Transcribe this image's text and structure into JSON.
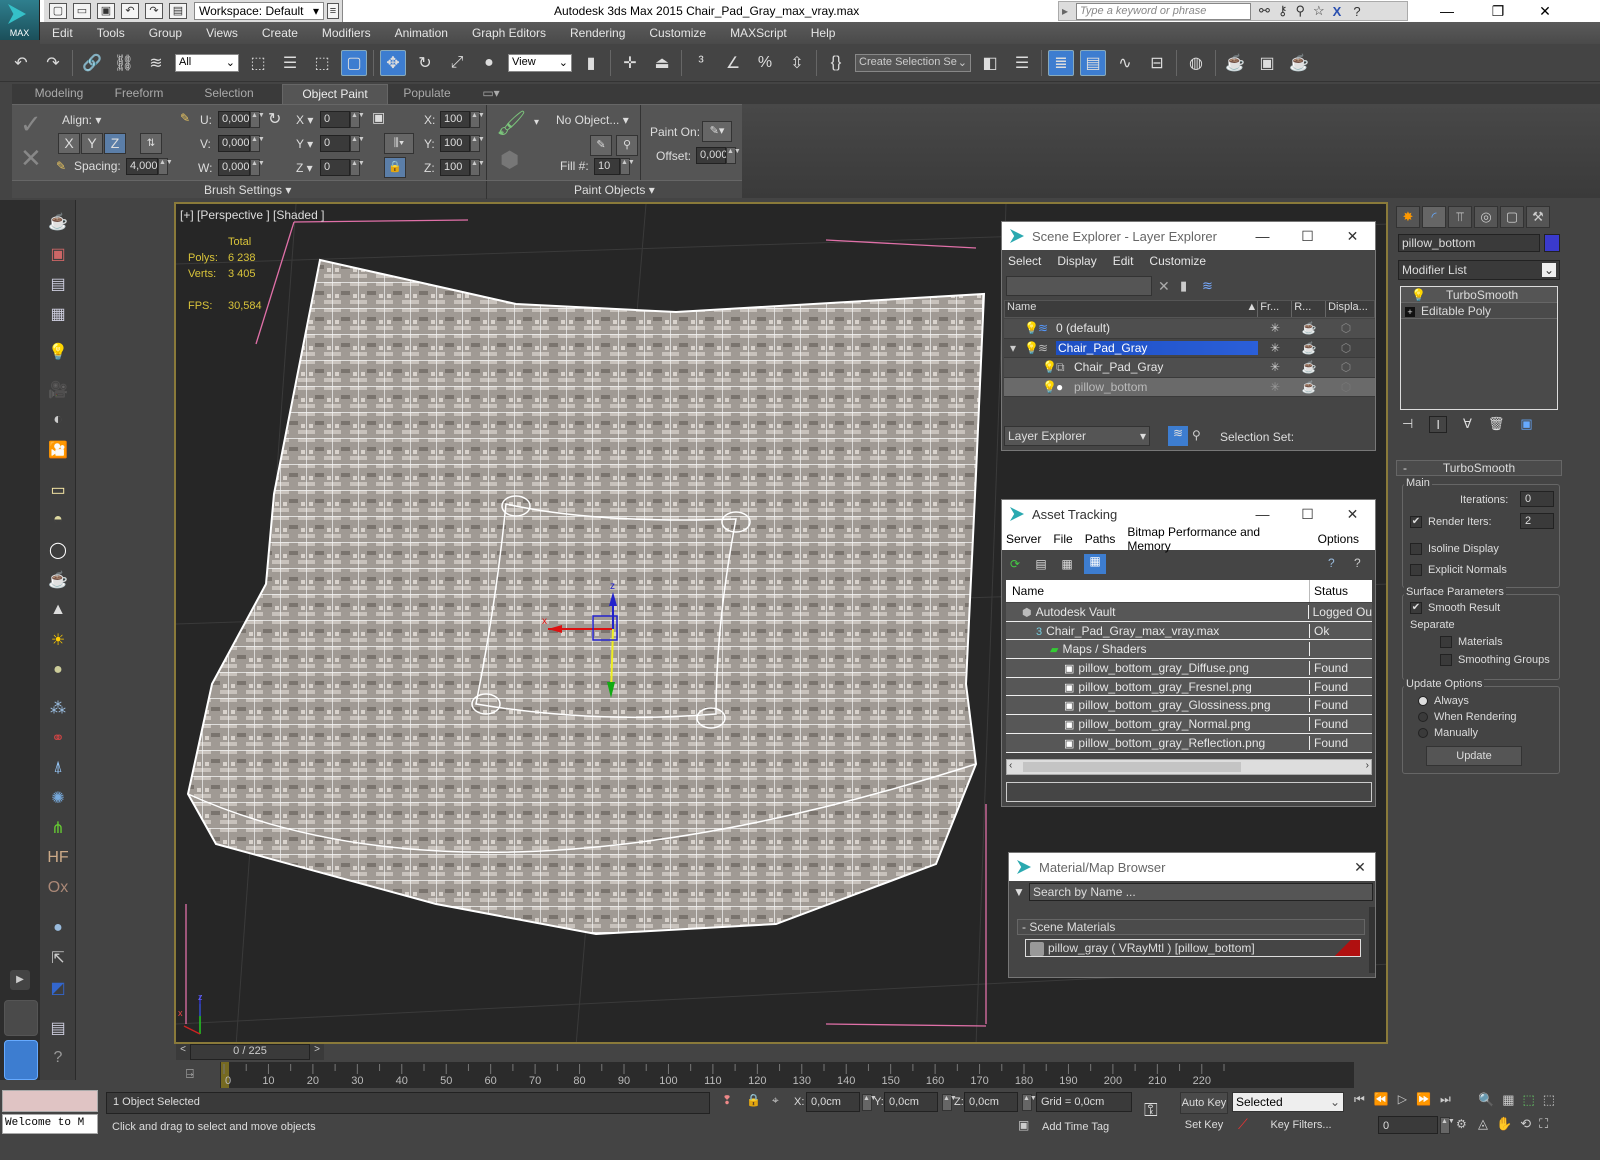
{
  "app": {
    "title": "Autodesk 3ds Max  2015    Chair_Pad_Gray_max_vray.max",
    "logo_label": "MAX",
    "workspace": "Workspace: Default",
    "search_placeholder": "Type a keyword or phrase",
    "window_buttons": {
      "minimize": "—",
      "restore": "❐",
      "close": "✕"
    }
  },
  "menu": [
    "Edit",
    "Tools",
    "Group",
    "Views",
    "Create",
    "Modifiers",
    "Animation",
    "Graph Editors",
    "Rendering",
    "Customize",
    "MAXScript",
    "Help"
  ],
  "toolbar": {
    "selection_filter": "All",
    "reference_coord": "View",
    "named_selection": "Create Selection Se"
  },
  "ribbon": {
    "tabs": [
      "Modeling",
      "Freeform",
      "Selection",
      "Object Paint",
      "Populate"
    ],
    "active_tab": "Object Paint",
    "align_label": "Align:",
    "axis_buttons": [
      "X",
      "Y",
      "Z"
    ],
    "active_axis": "Z",
    "spacing_label": "Spacing:",
    "spacing_value": "4,000",
    "u_label": "U:",
    "u_value": "0,000",
    "v_label": "V:",
    "v_value": "0,000",
    "w_label": "W:",
    "w_value": "0,000",
    "rx_label": "X",
    "rx_value": "0",
    "ry_label": "Y",
    "ry_value": "0",
    "rz_label": "Z",
    "rz_value": "0",
    "sx_label": "X:",
    "sx_value": "100",
    "sy_label": "Y:",
    "sy_value": "100",
    "sz_label": "Z:",
    "sz_value": "100",
    "no_object": "No Object...",
    "fill_label": "Fill #:",
    "fill_value": "10",
    "paint_on_label": "Paint On:",
    "offset_label": "Offset:",
    "offset_value": "0,000",
    "brush_settings": "Brush Settings",
    "paint_objects": "Paint Objects"
  },
  "viewport": {
    "label": "[+] [Perspective ] [Shaded ]",
    "stats": {
      "header": "Total",
      "polys_label": "Polys:",
      "polys": "6 238",
      "verts_label": "Verts:",
      "verts": "3 405",
      "fps_label": "FPS:",
      "fps": "30,584"
    },
    "gizmo": {
      "x": "x",
      "z": "z"
    },
    "axis_tripod": {
      "z": "z",
      "x": "x"
    }
  },
  "scene_explorer": {
    "title": "Scene Explorer - Layer Explorer",
    "menu": [
      "Select",
      "Display",
      "Edit",
      "Customize"
    ],
    "columns": [
      "Name",
      "Fr...",
      "R...",
      "Displa..."
    ],
    "rows": [
      {
        "name": "0 (default)",
        "level": 0,
        "selected": false
      },
      {
        "name": "Chair_Pad_Gray",
        "level": 0,
        "selected": true
      },
      {
        "name": "Chair_Pad_Gray",
        "level": 1,
        "selected": false
      },
      {
        "name": "pillow_bottom",
        "level": 1,
        "selected": false,
        "dimmed": true
      }
    ],
    "footer_dropdown": "Layer Explorer",
    "selection_set_label": "Selection Set:"
  },
  "asset_tracking": {
    "title": "Asset Tracking",
    "menu": [
      "Server",
      "File",
      "Paths",
      "Bitmap Performance and Memory",
      "Options"
    ],
    "columns": [
      "Name",
      "Status"
    ],
    "rows": [
      {
        "name": "Autodesk Vault",
        "status": "Logged Ou",
        "level": 1,
        "icon": "vault-icon"
      },
      {
        "name": "Chair_Pad_Gray_max_vray.max",
        "status": "Ok",
        "level": 2,
        "icon": "max-file-icon"
      },
      {
        "name": "Maps / Shaders",
        "status": "",
        "level": 3,
        "icon": "maps-icon"
      },
      {
        "name": "pillow_bottom_gray_Diffuse.png",
        "status": "Found",
        "level": 4,
        "icon": "image-file-icon"
      },
      {
        "name": "pillow_bottom_gray_Fresnel.png",
        "status": "Found",
        "level": 4,
        "icon": "image-file-icon"
      },
      {
        "name": "pillow_bottom_gray_Glossiness.png",
        "status": "Found",
        "level": 4,
        "icon": "image-file-icon"
      },
      {
        "name": "pillow_bottom_gray_Normal.png",
        "status": "Found",
        "level": 4,
        "icon": "image-file-icon"
      },
      {
        "name": "pillow_bottom_gray_Reflection.png",
        "status": "Found",
        "level": 4,
        "icon": "image-file-icon"
      }
    ]
  },
  "material_browser": {
    "title": "Material/Map Browser",
    "search_placeholder": "Search by Name ...",
    "section": "- Scene Materials",
    "item": "pillow_gray  ( VRayMtl ) [pillow_bottom]"
  },
  "command_panel": {
    "object_name": "pillow_bottom",
    "object_color": "#3a3acc",
    "modifier_list": "Modifier List",
    "stack": [
      "TurboSmooth",
      "Editable Poly"
    ],
    "rollout_title": "TurboSmooth",
    "main_label": "Main",
    "iterations_label": "Iterations:",
    "iterations": "0",
    "render_iters_label": "Render Iters:",
    "render_iters": "2",
    "render_iters_checked": true,
    "isoline_label": "Isoline Display",
    "isoline_checked": false,
    "explicit_normals_label": "Explicit Normals",
    "explicit_normals_checked": false,
    "surface_label": "Surface Parameters",
    "smooth_result_label": "Smooth Result",
    "smooth_result_checked": true,
    "separate_label": "Separate",
    "materials_label": "Materials",
    "materials_checked": false,
    "smoothing_groups_label": "Smoothing Groups",
    "smoothing_groups_checked": false,
    "update_options_label": "Update Options",
    "update_radio": [
      "Always",
      "When Rendering",
      "Manually"
    ],
    "update_selected": "Always",
    "update_button": "Update"
  },
  "timeline": {
    "frame_display": "0 / 225",
    "current_frame": 0,
    "total_frames": 225,
    "ticks": [
      "0",
      "10",
      "20",
      "30",
      "40",
      "50",
      "60",
      "70",
      "80",
      "90",
      "100",
      "110",
      "120",
      "130",
      "140",
      "150",
      "160",
      "170",
      "180",
      "190",
      "200",
      "210",
      "220"
    ]
  },
  "status": {
    "maxscript_listener": "Welcome to M",
    "selection_info": "1 Object Selected",
    "prompt": "Click and drag to select and move objects",
    "x_label": "X:",
    "x": "0,0cm",
    "y_label": "Y:",
    "y": "0,0cm",
    "z_label": "Z:",
    "z": "0,0cm",
    "grid": "Grid = 0,0cm",
    "add_time_tag": "Add Time Tag",
    "auto_key": "Auto Key",
    "set_key": "Set Key",
    "key_mode": "Selected",
    "key_filters": "Key Filters...",
    "frame_field": "0"
  }
}
